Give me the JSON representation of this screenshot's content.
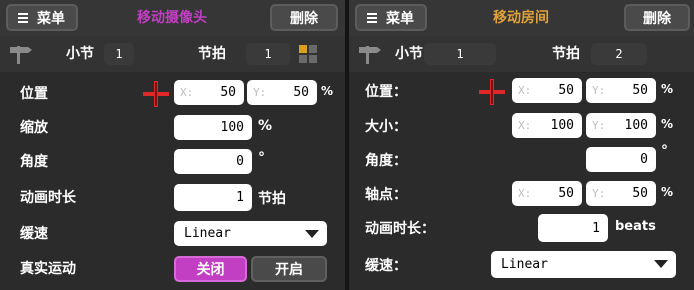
{
  "left": {
    "menu_label": "菜单",
    "title": "移动摄像头",
    "delete_label": "删除",
    "bar_label": "小节",
    "bar_value": "1",
    "beat_label": "节拍",
    "beat_value": "1",
    "position_label": "位置",
    "pos_x_placeholder": "X:",
    "pos_x_value": "50",
    "pos_y_placeholder": "Y:",
    "pos_y_value": "50",
    "pos_unit": "%",
    "zoom_label": "缩放",
    "zoom_value": "100",
    "zoom_unit": "%",
    "angle_label": "角度",
    "angle_value": "0",
    "angle_unit": "°",
    "duration_label": "动画时长",
    "duration_value": "1",
    "duration_unit": "节拍",
    "ease_label": "缓速",
    "ease_value": "Linear",
    "real_motion_label": "真实运动",
    "toggle_off_label": "关闭",
    "toggle_on_label": "开启"
  },
  "right": {
    "menu_label": "菜单",
    "title": "移动房间",
    "delete_label": "删除",
    "bar_label": "小节",
    "bar_value": "1",
    "beat_label": "节拍",
    "beat_value": "2",
    "position_label": "位置：",
    "pos_x_placeholder": "X:",
    "pos_x_value": "50",
    "pos_y_placeholder": "Y:",
    "pos_y_value": "50",
    "pos_unit": "%",
    "size_label": "大小：",
    "size_x_placeholder": "X:",
    "size_x_value": "100",
    "size_y_placeholder": "Y:",
    "size_y_value": "100",
    "size_unit": "%",
    "angle_label": "角度：",
    "angle_value": "0",
    "angle_unit": "°",
    "pivot_label": "轴点：",
    "pivot_x_placeholder": "X:",
    "pivot_x_value": "50",
    "pivot_y_placeholder": "Y:",
    "pivot_y_value": "50",
    "pivot_unit": "%",
    "duration_label": "动画时长：",
    "duration_value": "1",
    "duration_unit": "beats",
    "ease_label": "缓速：",
    "ease_value": "Linear"
  },
  "colors": {
    "left_title": "#c23fc4",
    "right_title": "#e0a33a",
    "toggle_active": "#c23fc4",
    "crosshair": "#e02828"
  },
  "icons": {
    "menu": "hamburger-icon",
    "bar_marker": "signpost-icon",
    "position_picker": "crosshair-icon",
    "room_grid": "grid-icon",
    "dropdown": "chevron-down-icon"
  }
}
